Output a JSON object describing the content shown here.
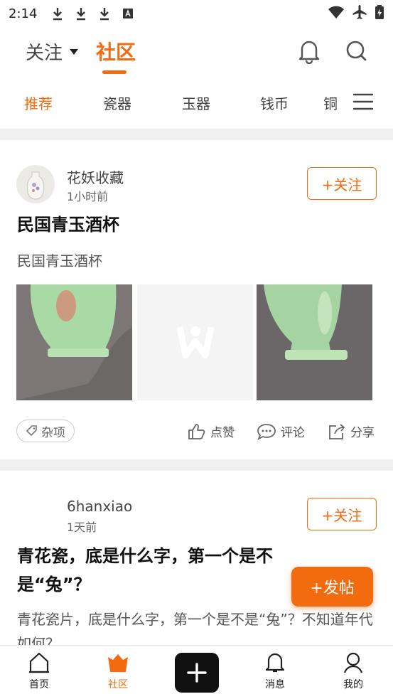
{
  "status_bar": {
    "time": "2:14"
  },
  "top_nav": {
    "follow_label": "关注",
    "community_label": "社区"
  },
  "categories": [
    {
      "label": "推荐",
      "active": true
    },
    {
      "label": "瓷器"
    },
    {
      "label": "玉器"
    },
    {
      "label": "钱币"
    },
    {
      "label": "铜"
    }
  ],
  "posts": [
    {
      "author": "花妖收藏",
      "time": "1小时前",
      "follow_label": "+关注",
      "title": "民国青玉酒杯",
      "desc": "民国青玉酒杯",
      "tag": "杂项",
      "actions": {
        "like": "点赞",
        "comment": "评论",
        "share": "分享"
      }
    },
    {
      "author": "6hanxiao",
      "time": "1天前",
      "follow_label": "+关注",
      "title": "青花瓷，底是什么字，第一个是不是“兔”？",
      "desc": "青花瓷片，底是什么字，第一个是不是“兔”？不知道年代如何？"
    }
  ],
  "fab": {
    "label": "+发帖"
  },
  "bottom_nav": [
    {
      "label": "首页",
      "icon": "home-icon"
    },
    {
      "label": "社区",
      "icon": "community-icon",
      "active": true
    },
    {
      "label": "",
      "icon": "plus-icon"
    },
    {
      "label": "消息",
      "icon": "bell-icon"
    },
    {
      "label": "我的",
      "icon": "user-icon"
    }
  ],
  "colors": {
    "accent": "#f26b0f",
    "text": "#222222",
    "separator": "#f0f0f0"
  }
}
